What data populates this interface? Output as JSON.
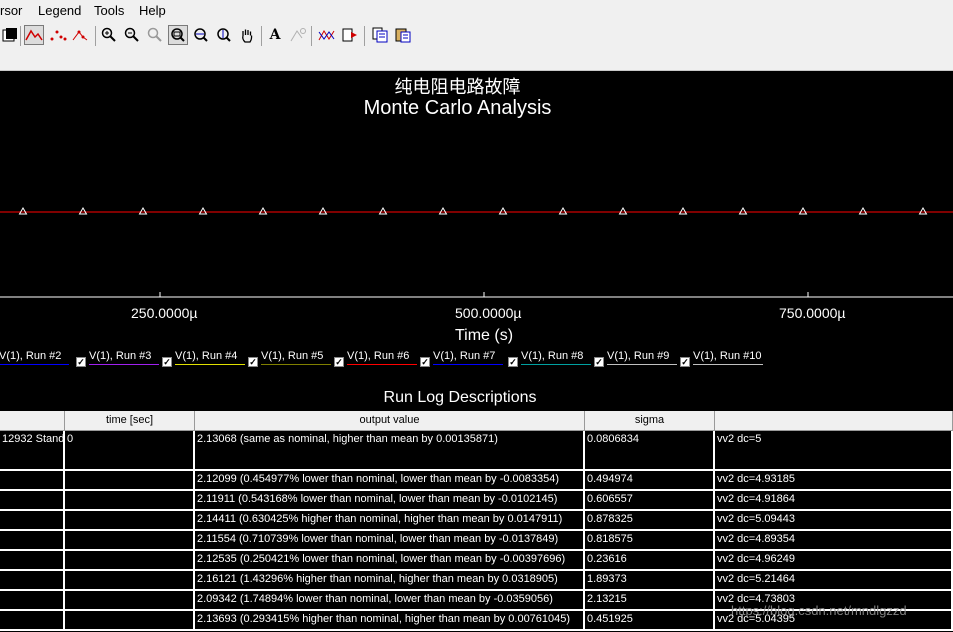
{
  "menu": [
    "rsor",
    "Legend",
    "Tools",
    "Help"
  ],
  "toolbar_icons": [
    "window-icon",
    "analog-trace-icon",
    "digital-dots-icon",
    "digital-line-icon",
    "zoom-in-icon",
    "zoom-out-icon",
    "zoom-fit-icon",
    "zoom-area-icon",
    "zoom-x-icon",
    "zoom-y-icon",
    "pan-hand-icon",
    "text-label-icon",
    "annotate-icon",
    "cursor-trace-icon",
    "export-icon",
    "copy-icon",
    "paste-icon"
  ],
  "text_tool_glyph": "A",
  "title": "纯电阻电路故障",
  "subtitle": "Monte Carlo Analysis",
  "chart_data": {
    "type": "line",
    "xlabel": "Time (s)",
    "ylabel": "",
    "x_ticks": [
      "250.0000µ",
      "500.0000µ",
      "750.0000µ"
    ],
    "x_tick_values": [
      0.00025,
      0.0005,
      0.00075
    ],
    "marker": "triangle",
    "line_color": "#ff0000",
    "marker_color": "#ffffff",
    "marker_count": 16,
    "grid": false,
    "legend_position": "bottom"
  },
  "legend": [
    {
      "label": "V(1), Run #2",
      "color": "#0000ff",
      "checked": false
    },
    {
      "label": "V(1), Run #3",
      "color": "#a020f0",
      "checked": true
    },
    {
      "label": "V(1), Run #4",
      "color": "#e0e000",
      "checked": true
    },
    {
      "label": "V(1), Run #5",
      "color": "#808000",
      "checked": true
    },
    {
      "label": "V(1), Run #6",
      "color": "#ff0000",
      "checked": true
    },
    {
      "label": "V(1), Run #7",
      "color": "#0000ff",
      "checked": true
    },
    {
      "label": "V(1), Run #8",
      "color": "#00a0a0",
      "checked": true
    },
    {
      "label": "V(1), Run #9",
      "color": "#c0c0c0",
      "checked": true
    },
    {
      "label": "V(1), Run #10",
      "color": "#c0c0c0",
      "checked": true
    }
  ],
  "runlog": {
    "title": "Run Log Descriptions",
    "columns": [
      "",
      "time [sec]",
      "output value",
      "sigma",
      ""
    ],
    "rows": [
      [
        "12932  Stand",
        "0",
        "2.13068 (same as nominal, higher than mean by 0.00135871)",
        "0.0806834",
        "vv2 dc=5"
      ],
      [
        "",
        "",
        "2.12099 (0.454977% lower than nominal, lower than mean by -0.0083354)",
        "0.494974",
        "vv2 dc=4.93185"
      ],
      [
        "",
        "",
        "2.11911 (0.543168% lower than nominal, lower than mean by -0.0102145)",
        "0.606557",
        "vv2 dc=4.91864"
      ],
      [
        "",
        "",
        "2.14411 (0.630425% higher than nominal, higher than mean by 0.0147911)",
        "0.878325",
        "vv2 dc=5.09443"
      ],
      [
        "",
        "",
        "2.11554 (0.710739% lower than nominal, lower than mean by -0.0137849)",
        "0.818575",
        "vv2 dc=4.89354"
      ],
      [
        "",
        "",
        "2.12535 (0.250421% lower than nominal, lower than mean by -0.00397696)",
        "0.23616",
        "vv2 dc=4.96249"
      ],
      [
        "",
        "",
        "2.16121 (1.43296% higher than nominal, higher than mean by 0.0318905)",
        "1.89373",
        "vv2 dc=5.21464"
      ],
      [
        "",
        "",
        "2.09342 (1.74894% lower than nominal, lower than mean by -0.0359056)",
        "2.13215",
        "vv2 dc=4.73803"
      ],
      [
        "",
        "",
        "2.13693 (0.293415% higher than nominal, higher than mean by 0.00761045)",
        "0.451925",
        "vv2 dc=5.04395"
      ]
    ]
  },
  "watermark": "https://blog.csdn.net/mndlgzzd"
}
